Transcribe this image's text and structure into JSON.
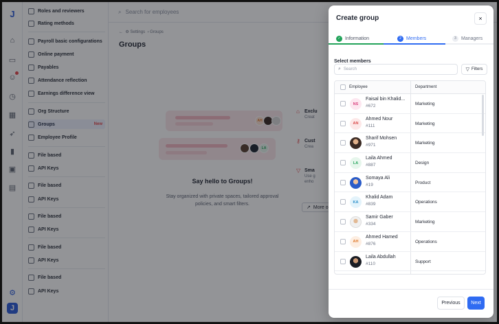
{
  "colors": {
    "accent": "#2f6bf2",
    "success": "#22a35a",
    "danger": "#e5484d",
    "overlay": "rgba(20,22,28,0.46)"
  },
  "rail": {
    "logo": "J",
    "icons": [
      "home-icon",
      "inbox-icon",
      "person-icon",
      "clock-icon",
      "building-icon",
      "rocket-icon",
      "chart-icon",
      "briefcase-icon",
      "calendar-icon",
      "gear-icon"
    ],
    "bottom_logo": "J"
  },
  "nav": {
    "items": [
      {
        "label": "Roles and reviewers"
      },
      {
        "label": "Rating methods"
      },
      {
        "label": "Payroll basic configurations"
      },
      {
        "label": "Online payment"
      },
      {
        "label": "Payables"
      },
      {
        "label": "Attendance reflection"
      },
      {
        "label": "Earnings difference view"
      },
      {
        "label": "Org Structure"
      },
      {
        "label": "Groups",
        "badge": "New"
      },
      {
        "label": "Employee Profile"
      },
      {
        "label": "File based"
      },
      {
        "label": "API Keys"
      },
      {
        "label": "File based"
      },
      {
        "label": "API Keys"
      },
      {
        "label": "File based"
      },
      {
        "label": "API Keys"
      },
      {
        "label": "File based"
      },
      {
        "label": "API Keys"
      },
      {
        "label": "File based"
      },
      {
        "label": "API Keys"
      }
    ]
  },
  "topbar": {
    "search_placeholder": "Search for employees"
  },
  "breadcrumb": {
    "back": "←",
    "parent": "Settings",
    "sep": "›",
    "current": "Groups"
  },
  "page": {
    "title": "Groups"
  },
  "empty_state": {
    "title": "Say hello to Groups!",
    "description": "Stay organized with private spaces, tailored approval policies, and smart filters.",
    "avatars": [
      "AH",
      "LA"
    ]
  },
  "features": [
    {
      "title": "Exclu",
      "desc": "Creat"
    },
    {
      "title": "Cust",
      "desc": "Crea"
    },
    {
      "title": "Sma",
      "desc": "Use g"
    }
  ],
  "features_extra": {
    "line2": "enho"
  },
  "more_button": "More on",
  "modal": {
    "title": "Create group",
    "close": "×",
    "steps": [
      {
        "num": "✓",
        "label": "Information",
        "state": "done"
      },
      {
        "num": "2",
        "label": "Members",
        "state": "active"
      },
      {
        "num": "3",
        "label": "Managers",
        "state": "todo"
      }
    ],
    "select_members_label": "Select members",
    "search_placeholder": "Search",
    "filters_label": "Filters",
    "table": {
      "col_employee": "Employee",
      "col_department": "Department",
      "rows": [
        {
          "initials": "NS",
          "avatar_style": "initials",
          "bg": "#fde7f0",
          "fg": "#d9417e",
          "name": "Faisal bin Khalid...",
          "id": "#672",
          "department": "Marketing"
        },
        {
          "initials": "AN",
          "avatar_style": "initials",
          "bg": "#fde8e8",
          "fg": "#d94b4b",
          "name": "Ahmed Nour",
          "id": "#111",
          "department": "Marketing"
        },
        {
          "initials": "",
          "avatar_style": "photo",
          "bg": "",
          "fg": "",
          "name": "Sharif Mohsen",
          "id": "#971",
          "department": "Marketing"
        },
        {
          "initials": "LA",
          "avatar_style": "initials",
          "bg": "#e6f6ec",
          "fg": "#22a35a",
          "name": "Laila Ahmed",
          "id": "#887",
          "department": "Design"
        },
        {
          "initials": "",
          "avatar_style": "photo3",
          "bg": "",
          "fg": "",
          "name": "Somaya Ali",
          "id": "#19",
          "department": "Product"
        },
        {
          "initials": "KA",
          "avatar_style": "initials",
          "bg": "#e3f3fb",
          "fg": "#2b8fc9",
          "name": "Khalid Adam",
          "id": "#839",
          "department": "Operations"
        },
        {
          "initials": "",
          "avatar_style": "photo4",
          "bg": "",
          "fg": "",
          "name": "Samir Gaber",
          "id": "#334",
          "department": "Marketing"
        },
        {
          "initials": "AH",
          "avatar_style": "initials",
          "bg": "#fdeee2",
          "fg": "#e07a2c",
          "name": "Ahmed Hamed",
          "id": "#876",
          "department": "Operations"
        },
        {
          "initials": "",
          "avatar_style": "photo2",
          "bg": "",
          "fg": "",
          "name": "Laila Abdullah",
          "id": "#110",
          "department": "Support"
        }
      ]
    },
    "previous_label": "Previous",
    "next_label": "Next"
  }
}
